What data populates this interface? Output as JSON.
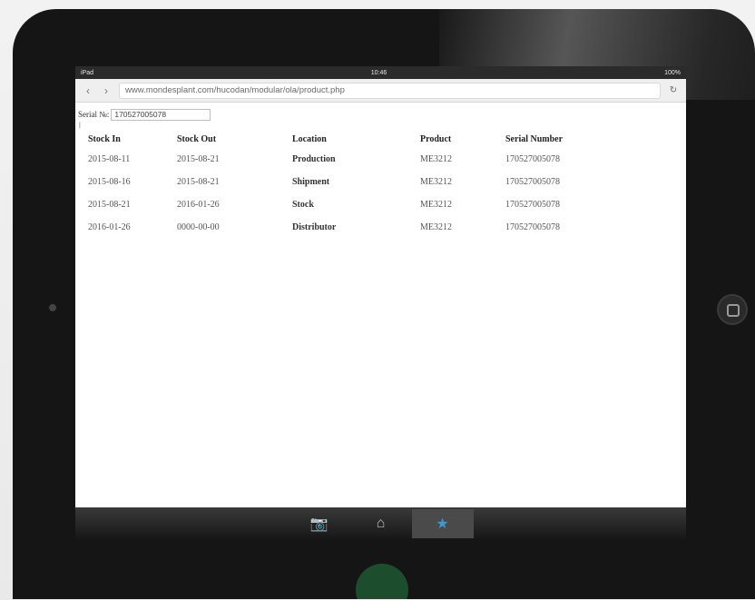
{
  "device": {
    "status_left": "iPad",
    "status_center": "10:46",
    "status_right": "100%"
  },
  "browser": {
    "url": "www.mondesplant.com/hucodan/modular/ola/product.php",
    "back_icon": "back-arrow-icon",
    "forward_icon": "forward-arrow-icon",
    "refresh_icon": "refresh-icon"
  },
  "form": {
    "serial_label": "Serial №:",
    "serial_value": "170527005078",
    "tiny_mark": "|"
  },
  "table": {
    "headers": [
      "Stock In",
      "Stock Out",
      "Location",
      "Product",
      "Serial Number"
    ],
    "rows": [
      [
        "2015-08-11",
        "2015-08-21",
        "Production",
        "ME3212",
        "170527005078"
      ],
      [
        "2015-08-16",
        "2015-08-21",
        "Shipment",
        "ME3212",
        "170527005078"
      ],
      [
        "2015-08-21",
        "2016-01-26",
        "Stock",
        "ME3212",
        "170527005078"
      ],
      [
        "2016-01-26",
        "0000-00-00",
        "Distributor",
        "ME3212",
        "170527005078"
      ]
    ]
  },
  "toolbar": {
    "tabs": [
      {
        "icon": "camera-icon",
        "glyph": "📷"
      },
      {
        "icon": "home-icon",
        "glyph": "⌂"
      },
      {
        "icon": "star-icon",
        "glyph": "★"
      }
    ]
  },
  "colors": {
    "toolbar_active": "#3a9ad9",
    "device_body": "#151515",
    "accent_dot": "#1c4d2c"
  }
}
